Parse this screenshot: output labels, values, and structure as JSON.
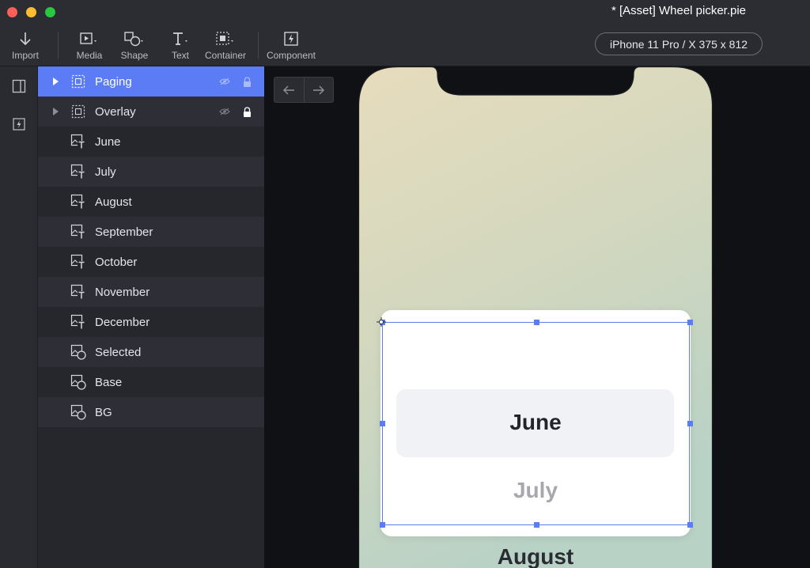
{
  "window": {
    "title": "* [Asset] Wheel picker.pie"
  },
  "toolbar": {
    "import_label": "Import",
    "media_label": "Media",
    "shape_label": "Shape",
    "text_label": "Text",
    "container_label": "Container",
    "component_label": "Component",
    "device_label": "iPhone 11 Pro / X  375 x 812"
  },
  "layers": {
    "items": [
      {
        "name": "Paging",
        "icon": "container-icon",
        "expandable": true,
        "selected": true
      },
      {
        "name": "Overlay",
        "icon": "container-icon",
        "expandable": true,
        "selected": false
      },
      {
        "name": "June",
        "icon": "text-image-icon",
        "expandable": false,
        "selected": false
      },
      {
        "name": "July",
        "icon": "text-image-icon",
        "expandable": false,
        "selected": false
      },
      {
        "name": "August",
        "icon": "text-image-icon",
        "expandable": false,
        "selected": false
      },
      {
        "name": "September",
        "icon": "text-image-icon",
        "expandable": false,
        "selected": false
      },
      {
        "name": "October",
        "icon": "text-image-icon",
        "expandable": false,
        "selected": false
      },
      {
        "name": "November",
        "icon": "text-image-icon",
        "expandable": false,
        "selected": false
      },
      {
        "name": "December",
        "icon": "text-image-icon",
        "expandable": false,
        "selected": false
      },
      {
        "name": "Selected",
        "icon": "shape-image-icon",
        "expandable": false,
        "selected": false
      },
      {
        "name": "Base",
        "icon": "shape-image-icon",
        "expandable": false,
        "selected": false
      },
      {
        "name": "BG",
        "icon": "shape-image-icon",
        "expandable": false,
        "selected": false
      }
    ]
  },
  "picker": {
    "selected_month": "June",
    "next_month": "July",
    "third_month": "August"
  },
  "colors": {
    "accent": "#5b7cf5",
    "selection": "#5a7ef0",
    "panel_bg": "#26272d",
    "toolbar_bg": "#2c2d33"
  }
}
